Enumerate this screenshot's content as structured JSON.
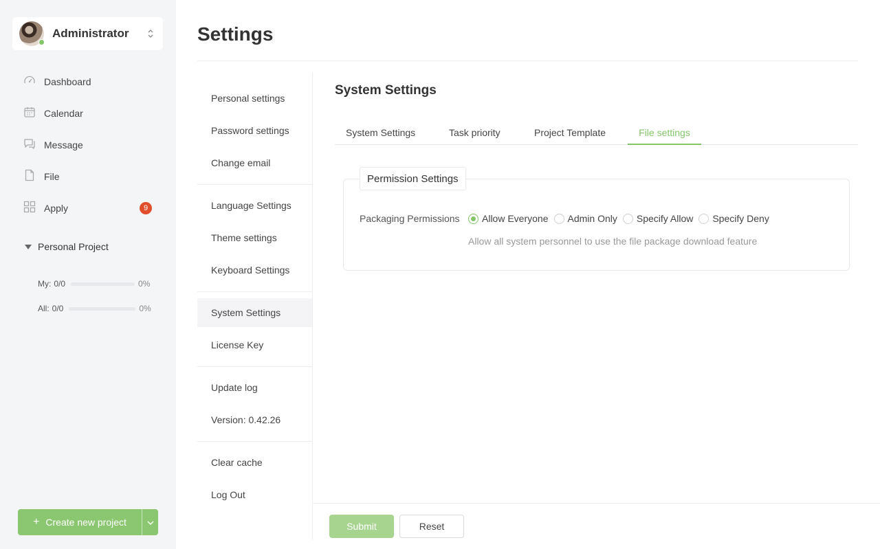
{
  "sidebar": {
    "user": {
      "name": "Administrator",
      "status": "online"
    },
    "nav": [
      {
        "label": "Dashboard",
        "icon": "dashboard-icon"
      },
      {
        "label": "Calendar",
        "icon": "calendar-icon"
      },
      {
        "label": "Message",
        "icon": "message-icon"
      },
      {
        "label": "File",
        "icon": "file-icon"
      },
      {
        "label": "Apply",
        "icon": "apps-icon",
        "badge": "9"
      }
    ],
    "project": {
      "title": "Personal Project",
      "my": {
        "label": "My:",
        "count": "0/0",
        "percent": "0%",
        "progress": 0
      },
      "all": {
        "label": "All:",
        "count": "0/0",
        "percent": "0%",
        "progress": 0
      }
    },
    "create_button": {
      "icon": "+",
      "label": "Create new project"
    }
  },
  "page": {
    "title": "Settings"
  },
  "settings_menu": [
    "Personal settings",
    "Password settings",
    "Change email",
    "Language Settings",
    "Theme settings",
    "Keyboard Settings",
    "System Settings",
    "License Key",
    "Update log",
    "Version: 0.42.26",
    "Clear cache",
    "Log Out"
  ],
  "settings_menu_active": "System Settings",
  "content": {
    "title": "System Settings",
    "tabs": [
      "System Settings",
      "Task priority",
      "Project Template",
      "File settings"
    ],
    "active_tab": "File settings",
    "permission": {
      "legend": "Permission Settings",
      "label": "Packaging Permissions",
      "options": [
        "Allow Everyone",
        "Admin Only",
        "Specify Allow",
        "Specify Deny"
      ],
      "selected": "Allow Everyone",
      "description": "Allow all system personnel to use the file package download feature"
    },
    "buttons": {
      "submit": "Submit",
      "reset": "Reset"
    }
  },
  "colors": {
    "accent": "#84c56a",
    "badge": "#e04e2d",
    "sidebar_bg": "#f4f5f7"
  }
}
